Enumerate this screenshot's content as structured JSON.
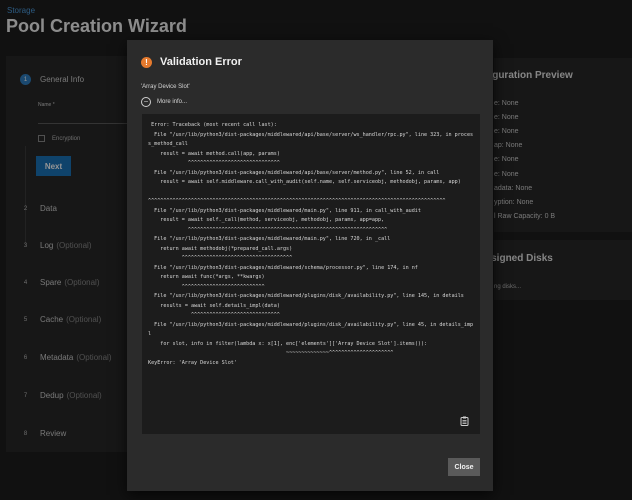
{
  "header": {
    "breadcrumb": "Storage",
    "title": "Pool Creation Wizard"
  },
  "wizard": {
    "steps": [
      {
        "num": "1",
        "label": "General Info",
        "optional": ""
      },
      {
        "num": "2",
        "label": "Data",
        "optional": ""
      },
      {
        "num": "3",
        "label": "Log",
        "optional": "(Optional)"
      },
      {
        "num": "4",
        "label": "Spare",
        "optional": "(Optional)"
      },
      {
        "num": "5",
        "label": "Cache",
        "optional": "(Optional)"
      },
      {
        "num": "6",
        "label": "Metadata",
        "optional": "(Optional)"
      },
      {
        "num": "7",
        "label": "Dedup",
        "optional": "(Optional)"
      },
      {
        "num": "8",
        "label": "Review",
        "optional": ""
      }
    ],
    "name_label": "Name *",
    "encryption_label": "Encryption",
    "next_label": "Next"
  },
  "preview": {
    "title": "nfiguration Preview",
    "rows": [
      "e: None",
      "e: None",
      "e: None",
      "ap: None",
      "e: None",
      "e: None",
      "adata: None",
      "yption: None",
      "l Raw Capacity: 0 B"
    ]
  },
  "unassigned": {
    "title": "assigned Disks",
    "text": "ng disks..."
  },
  "dialog": {
    "title": "Validation Error",
    "message": "'Array Device Slot'",
    "more_info": "More info...",
    "traceback": " Error: Traceback (most recent call last):\n  File \"/usr/lib/python3/dist-packages/middlewared/api/base/server/ws_handler/rpc.py\", line 323, in process_method_call\n    result = await method.call(app, params)\n             ^^^^^^^^^^^^^^^^^^^^^^^^^^^^^^\n  File \"/usr/lib/python3/dist-packages/middlewared/api/base/server/method.py\", line 52, in call\n    result = await self.middleware.call_with_audit(self.name, self.serviceobj, methodobj, params, app)\n\n^^^^^^^^^^^^^^^^^^^^^^^^^^^^^^^^^^^^^^^^^^^^^^^^^^^^^^^^^^^^^^^^^^^^^^^^^^^^^^^^^^^^^^^^^^^^^^^^^\n  File \"/usr/lib/python3/dist-packages/middlewared/main.py\", line 911, in call_with_audit\n    result = await self._call(method, serviceobj, methodobj, params, app=app,\n             ^^^^^^^^^^^^^^^^^^^^^^^^^^^^^^^^^^^^^^^^^^^^^^^^^^^^^^^^^^^^^^^^^\n  File \"/usr/lib/python3/dist-packages/middlewared/main.py\", line 720, in _call\n    return await methodobj(*prepared_call.args)\n           ^^^^^^^^^^^^^^^^^^^^^^^^^^^^^^^^^^^^\n  File \"/usr/lib/python3/dist-packages/middlewared/schema/processor.py\", line 174, in nf\n    return await func(*args, **kwargs)\n           ^^^^^^^^^^^^^^^^^^^^^^^^^^^\n  File \"/usr/lib/python3/dist-packages/middlewared/plugins/disk_/availability.py\", line 145, in details\n    results = await self.details_impl(data)\n              ^^^^^^^^^^^^^^^^^^^^^^^^^^^^^\n  File \"/usr/lib/python3/dist-packages/middlewared/plugins/disk_/availability.py\", line 45, in details_impl\n    for slot, info in filter(lambda x: x[1], enc['elements']['Array Device Slot'].items()):\n                                             ~~~~~~~~~~~~~~^^^^^^^^^^^^^^^^^^^^^\nKeyError: 'Array Device Slot'",
    "close_label": "Close"
  }
}
